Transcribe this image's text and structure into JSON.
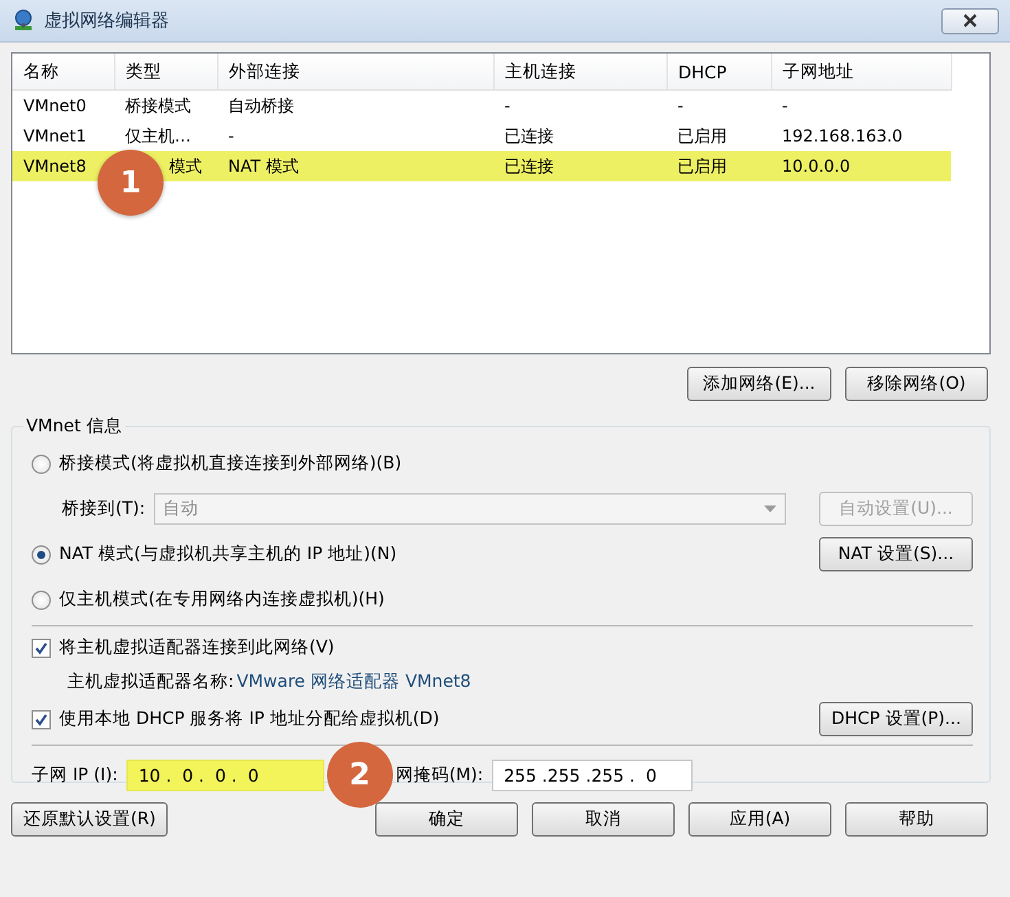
{
  "window": {
    "title": "虚拟网络编辑器"
  },
  "table": {
    "columns": [
      "名称",
      "类型",
      "外部连接",
      "主机连接",
      "DHCP",
      "子网地址"
    ],
    "rows": [
      {
        "cells": [
          "VMnet0",
          "桥接模式",
          "自动桥接",
          "-",
          "-",
          "-"
        ],
        "selected": false
      },
      {
        "cells": [
          "VMnet1",
          "仅主机…",
          "-",
          "已连接",
          "已启用",
          "192.168.163.0"
        ],
        "selected": false
      },
      {
        "cells": [
          "VMnet8",
          "模式",
          "NAT 模式",
          "已连接",
          "已启用",
          "10.0.0.0"
        ],
        "selected": true
      }
    ]
  },
  "callouts": [
    {
      "label": "1"
    },
    {
      "label": "2"
    }
  ],
  "table_buttons": [
    "添加网络(E)...",
    "移除网络(O)"
  ],
  "vmnet_info": {
    "title": "VMnet 信息",
    "modes": [
      {
        "kind": "bridged",
        "label": "桥接模式(将虚拟机直接连接到外部网络)(B)",
        "selected": false
      },
      {
        "kind": "nat",
        "label": "NAT 模式(与虚拟机共享主机的 IP 地址)(N)",
        "selected": true
      },
      {
        "kind": "host_only",
        "label": "仅主机模式(在专用网络内连接虚拟机)(H)",
        "selected": false
      }
    ],
    "bridge_to": {
      "label": "桥接到(T):",
      "value": "自动",
      "disabled": true
    },
    "auto_settings_button": {
      "label": "自动设置(U)...",
      "disabled": true
    },
    "nat_settings_button": "NAT 设置(S)...",
    "connect_adapter": {
      "label": "将主机虚拟适配器连接到此网络(V)",
      "checked": true
    },
    "adapter_name": {
      "label": "主机虚拟适配器名称:",
      "value": "VMware 网络适配器 VMnet8"
    },
    "use_dhcp": {
      "label": "使用本地 DHCP 服务将 IP 地址分配给虚拟机(D)",
      "checked": true
    },
    "dhcp_settings_button": "DHCP 设置(P)...",
    "subnet_ip": {
      "label": "子网 IP (I):",
      "value": "10 .  0 .  0 .  0",
      "highlighted": true
    },
    "subnet_mask": {
      "label": "网掩码(M):",
      "value": "255 .255 .255 .  0"
    }
  },
  "restore_button": "还原默认设置(R)",
  "buttons": [
    "确定",
    "取消",
    "应用(A)",
    "帮助"
  ]
}
